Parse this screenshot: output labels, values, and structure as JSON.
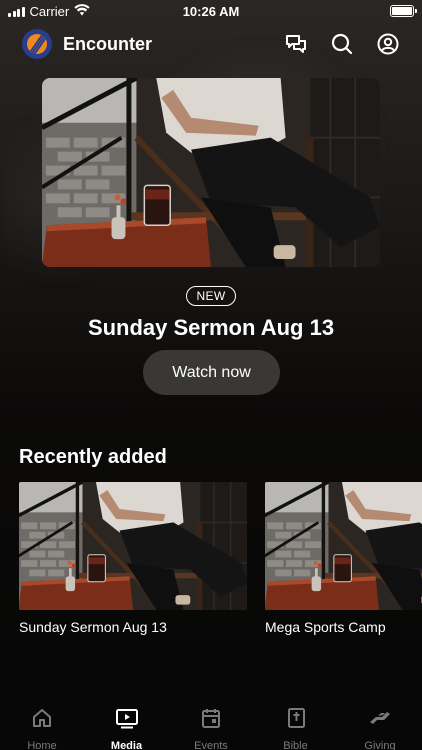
{
  "status_bar": {
    "carrier": "Carrier",
    "time": "10:26 AM",
    "signal_bars": 4,
    "battery_level": 1.0
  },
  "header": {
    "title": "Encounter",
    "logo_colors": {
      "ring": "#2a3c8e",
      "fill": "#f08a1c"
    },
    "actions": [
      {
        "icon": "chat-bubbles-icon"
      },
      {
        "icon": "search-icon"
      },
      {
        "icon": "profile-icon"
      }
    ]
  },
  "featured": {
    "badge": "NEW",
    "title": "Sunday Sermon Aug 13",
    "button_label": "Watch now",
    "image": "man-seated-in-chair-with-drink-photo"
  },
  "recently_added": {
    "title": "Recently added",
    "items": [
      {
        "title": "Sunday Sermon Aug 13",
        "image": "man-seated-in-chair-photo"
      },
      {
        "title": "Mega Sports Camp",
        "image": "man-seated-in-chair-photo"
      }
    ]
  },
  "tab_bar": {
    "active": "Media",
    "items": [
      {
        "label": "Home",
        "icon": "home-icon"
      },
      {
        "label": "Media",
        "icon": "video-play-icon"
      },
      {
        "label": "Events",
        "icon": "calendar-icon"
      },
      {
        "label": "Bible",
        "icon": "bible-icon"
      },
      {
        "label": "Giving",
        "icon": "giving-hand-icon"
      }
    ]
  },
  "colors": {
    "accent_text": "#ffffff",
    "inactive_tab": "#7a7a7a",
    "button_bg": "#3a3836"
  }
}
